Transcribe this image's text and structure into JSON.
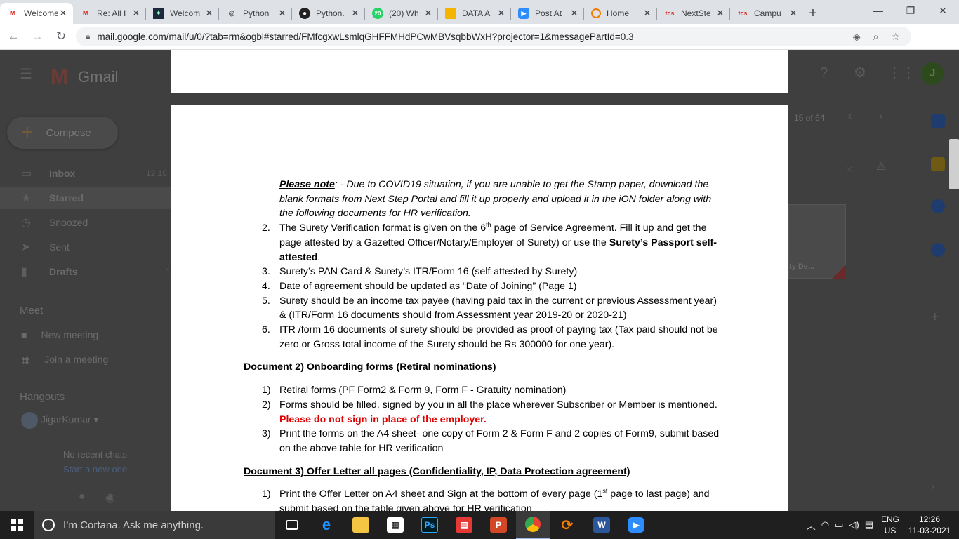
{
  "browser": {
    "tabs": [
      {
        "icon": "gmail-icon",
        "title": "Welcome",
        "active": true
      },
      {
        "icon": "gmail-icon",
        "title": "Re: All I"
      },
      {
        "icon": "dark-site-icon",
        "title": "Welcom"
      },
      {
        "icon": "globe-icon",
        "title": "Python"
      },
      {
        "icon": "github-icon",
        "title": "Python."
      },
      {
        "icon": "whatsapp-icon",
        "title": "(20) Wh"
      },
      {
        "icon": "slides-icon",
        "title": "DATA A"
      },
      {
        "icon": "zoom-icon",
        "title": "Post At"
      },
      {
        "icon": "orange-circle-icon",
        "title": "Home"
      },
      {
        "icon": "tcs-icon",
        "title": "NextSte"
      },
      {
        "icon": "tcs-icon",
        "title": "Campu"
      }
    ],
    "url": "mail.google.com/mail/u/0/?tab=rm&ogbl#starred/FMfcgxwLsmlqGHFFMHdPCwMBVsqbbWxH?projector=1&messagePartId=0.3",
    "profile_initial": "J"
  },
  "gmail": {
    "logo_text": "Gmail",
    "compose_label": "Compose",
    "sidebar": [
      {
        "icon": "inbox-icon",
        "label": "Inbox",
        "count": "12,18"
      },
      {
        "icon": "star-icon",
        "label": "Starred",
        "count": ""
      },
      {
        "icon": "clock-icon",
        "label": "Snoozed",
        "count": ""
      },
      {
        "icon": "send-icon",
        "label": "Sent",
        "count": ""
      },
      {
        "icon": "draft-icon",
        "label": "Drafts",
        "count": "1"
      }
    ],
    "meet_heading": "Meet",
    "meet_items": [
      "New meeting",
      "Join a meeting"
    ],
    "hangouts_heading": "Hangouts",
    "hangouts_user": "JigarKumar",
    "no_chats": "No recent chats",
    "start_new": "Start a new one",
    "pager": "15 of 64",
    "attachment_label": "ty De..."
  },
  "document": {
    "note_label": "Please note",
    "note_text": ": - Due to COVID19 situation, if you are unable to get the Stamp paper, download the blank formats from Next Step Portal and fill it up properly and upload it in the iON folder along with the following documents for HR verification.",
    "items1": [
      {
        "num": "2.",
        "pre": "The Surety Verification format is given on the 6",
        "sup": "th",
        "post": " page of Service Agreement. Fill it up and get the page attested by a Gazetted Officer/Notary/Employer of Surety) or use the ",
        "bold": "Surety’s Passport self-attested",
        "tail": "."
      },
      {
        "num": "3.",
        "text": "Surety’s PAN Card & Surety’s ITR/Form 16 (self-attested by Surety)"
      },
      {
        "num": "4.",
        "text": "Date of agreement should be updated as “Date of Joining” (Page 1)"
      },
      {
        "num": "5.",
        "text": "Surety should be an income tax payee (having paid tax in the current or previous Assessment year) & (ITR/Form 16 documents should from Assessment year 2019-20 or 2020-21)"
      },
      {
        "num": "6.",
        "text": "ITR /form 16 documents of surety should be provided as proof of paying tax (Tax paid should not be zero or Gross total income of the Surety should be Rs 300000 for one year)."
      }
    ],
    "heading2": "Document 2) Onboarding forms (Retiral nominations)",
    "items2": [
      {
        "num": "1)",
        "text": "Retiral forms (PF Form2 & Form 9, Form F - Gratuity nomination)"
      },
      {
        "num": "2)",
        "text": "Forms should be filled, signed by you in all the place wherever Subscriber or Member is mentioned.  ",
        "red": "Please do not sign in place of the employer."
      },
      {
        "num": "3)",
        "text": "Print the forms on the A4 sheet- one copy of Form 2 & Form F and 2 copies of Form9, submit based on the above table for HR verification"
      }
    ],
    "heading3": "Document 3) Offer Letter all pages (Confidentiality, IP, Data Protection agreement)",
    "items3": [
      {
        "num": "1)",
        "pre": "Print the Offer Letter on A4 sheet and Sign at the bottom of every page (1",
        "sup": "st",
        "post": " page to last page) and submit based on the table given above  for HR verification"
      }
    ]
  },
  "taskbar": {
    "search_placeholder": "I’m Cortana. Ask me anything.",
    "apps": [
      "task-view-icon",
      "edge-icon",
      "file-explorer-icon",
      "store-icon",
      "photoshop-icon",
      "red-book-icon",
      "powerpoint-icon",
      "chrome-icon",
      "sync-icon",
      "word-icon",
      "zoom-icon"
    ],
    "lang_top": "ENG",
    "lang_bottom": "US",
    "time": "12:26",
    "date": "11-03-2021"
  },
  "colors": {
    "red_text": "#e00000",
    "gmail_dim_bg": "#3f3f3f",
    "taskbar_bg": "#1f1f1f"
  }
}
